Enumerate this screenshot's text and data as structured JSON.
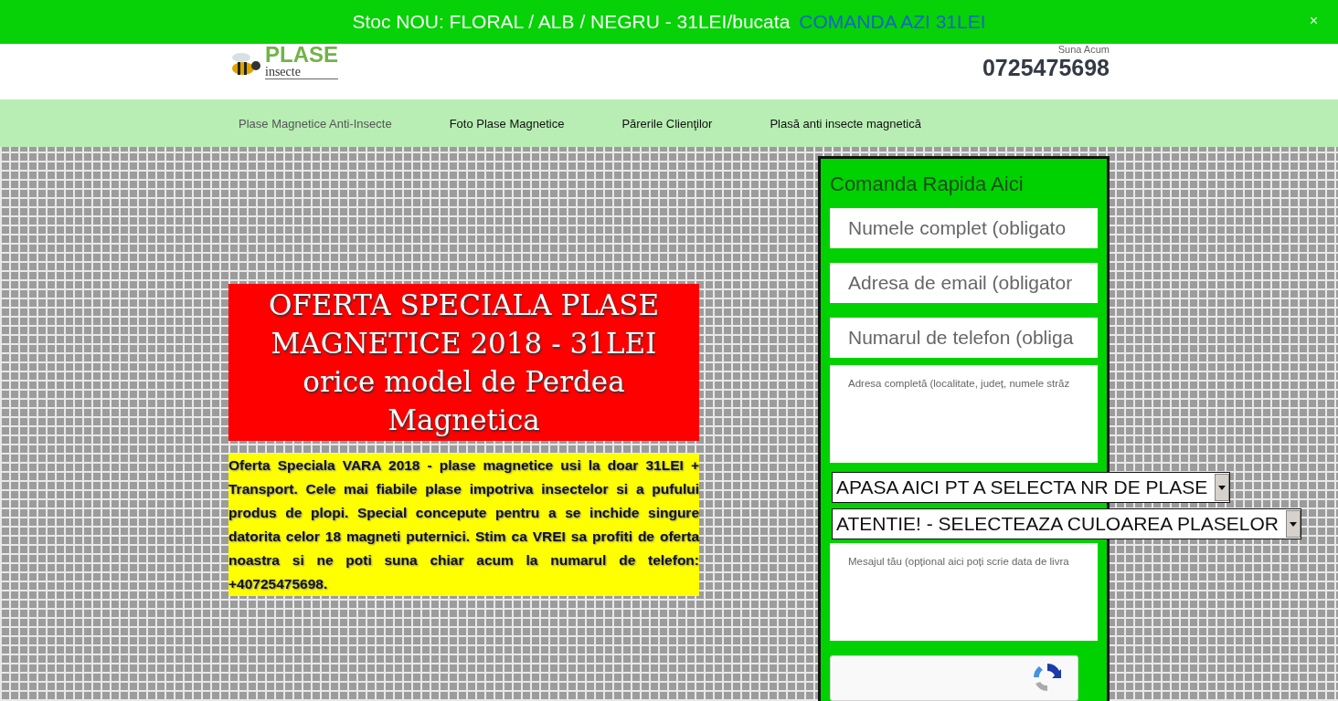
{
  "banner": {
    "text": "Stoc NOU: FLORAL / ALB / NEGRU - 31LEI/bucata",
    "link": "COMANDA AZI 31LEI",
    "close": "×"
  },
  "header": {
    "logo": {
      "title": "PLASE",
      "subtitle": "insecte"
    },
    "call_label": "Suna Acum",
    "phone": "0725475698"
  },
  "nav": [
    {
      "label": "Plase Magnetice Anti-Insecte",
      "selected": true
    },
    {
      "label": "Foto Plase Magnetice",
      "selected": false
    },
    {
      "label": "Părerile Clienţilor",
      "selected": false
    },
    {
      "label": "Plasă anti insecte magnetică",
      "selected": false
    }
  ],
  "offer": {
    "title": "OFERTA SPECIALA PLASE MAGNETICE 2018 - 31LEI orice model de Perdea Magnetica",
    "text": "Oferta Speciala VARA 2018 - plase magnetice usi la doar 31LEI + Transport. Cele mai fiabile plase impotriva insectelor si a pufului produs de plopi. Special concepute pentru a se inchide singure datorita celor 18 magneti puternici. Stim ca VREI sa profiti de oferta noastra si ne poti suna chiar acum la numarul de telefon: +40725475698."
  },
  "order_form": {
    "title": "Comanda Rapida Aici",
    "fields": [
      {
        "kind": "input",
        "placeholder": "Numele complet (obligato"
      },
      {
        "kind": "input",
        "placeholder": "Adresa de email (obligator"
      },
      {
        "kind": "input",
        "placeholder": "Numarul de telefon (obliga"
      },
      {
        "kind": "textarea",
        "placeholder": "Adresa completă (localitate, județ, numele străz"
      },
      {
        "kind": "select",
        "value": "APASA AICI PT A SELECTA NR DE PLASE"
      },
      {
        "kind": "select",
        "value": "ATENTIE! - SELECTEAZA CULOAREA PLASELOR"
      },
      {
        "kind": "textarea",
        "placeholder": "Mesajul tău (opțional aici poți scrie data de livra"
      },
      {
        "kind": "captcha"
      }
    ]
  }
}
